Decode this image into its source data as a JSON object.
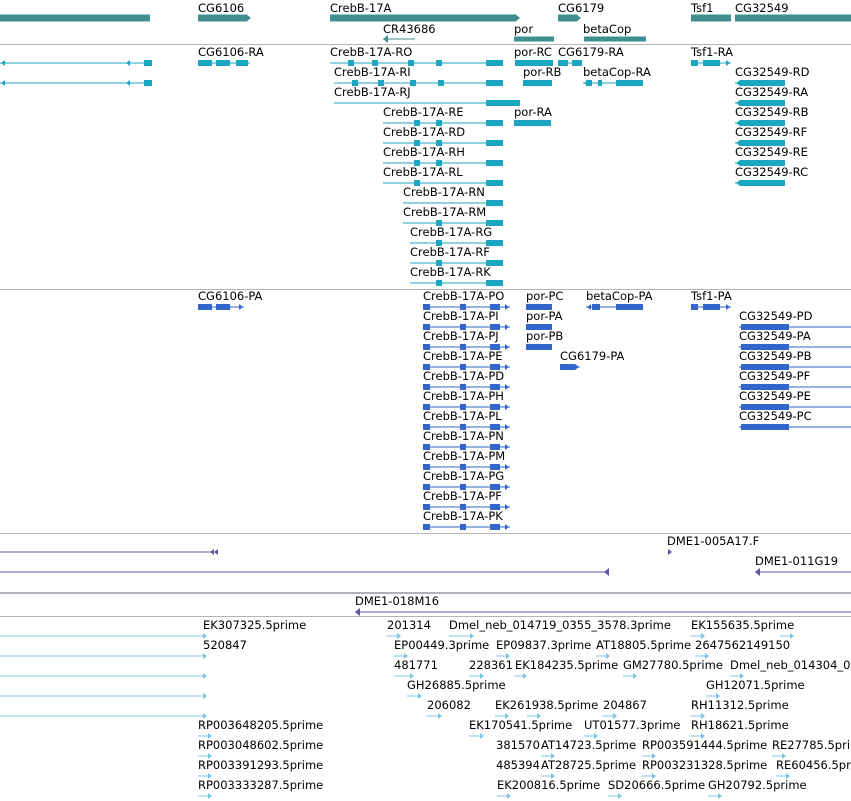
{
  "colors": {
    "gene": "#3f8f8f",
    "transcript": "#1ba6c2",
    "protein": "#3366cc",
    "bac": "#6650a8",
    "est": "#7fc3e0",
    "separator": "#b4b4b4"
  },
  "tracks": {
    "genes": [
      {
        "label": "CG6106"
      },
      {
        "label": "CrebB-17A"
      },
      {
        "label": "CG6179"
      },
      {
        "label": "Tsf1"
      },
      {
        "label": "CG32549"
      },
      {
        "label": "CR43686"
      },
      {
        "label": "por"
      },
      {
        "label": "betaCop"
      }
    ],
    "transcripts": [
      {
        "label": "CG6106-RA"
      },
      {
        "label": "CrebB-17A-RO"
      },
      {
        "label": "por-RC"
      },
      {
        "label": "CG6179-RA"
      },
      {
        "label": "Tsf1-RA"
      },
      {
        "label": "CrebB-17A-RI"
      },
      {
        "label": "por-RB"
      },
      {
        "label": "betaCop-RA"
      },
      {
        "label": "CG32549-RD"
      },
      {
        "label": "CrebB-17A-RJ"
      },
      {
        "label": "CG32549-RA"
      },
      {
        "label": "CrebB-17A-RE"
      },
      {
        "label": "por-RA"
      },
      {
        "label": "CG32549-RB"
      },
      {
        "label": "CrebB-17A-RD"
      },
      {
        "label": "CG32549-RF"
      },
      {
        "label": "CrebB-17A-RH"
      },
      {
        "label": "CG32549-RE"
      },
      {
        "label": "CrebB-17A-RL"
      },
      {
        "label": "CG32549-RC"
      },
      {
        "label": "CrebB-17A-RN"
      },
      {
        "label": "CrebB-17A-RM"
      },
      {
        "label": "CrebB-17A-RG"
      },
      {
        "label": "CrebB-17A-RF"
      },
      {
        "label": "CrebB-17A-RK"
      }
    ],
    "proteins": [
      {
        "label": "CG6106-PA"
      },
      {
        "label": "CrebB-17A-PO"
      },
      {
        "label": "por-PC"
      },
      {
        "label": "betaCop-PA"
      },
      {
        "label": "Tsf1-PA"
      },
      {
        "label": "CrebB-17A-PI"
      },
      {
        "label": "por-PA"
      },
      {
        "label": "CG32549-PD"
      },
      {
        "label": "CrebB-17A-PJ"
      },
      {
        "label": "por-PB"
      },
      {
        "label": "CG32549-PA"
      },
      {
        "label": "CrebB-17A-PE"
      },
      {
        "label": "CG6179-PA"
      },
      {
        "label": "CG32549-PB"
      },
      {
        "label": "CrebB-17A-PD"
      },
      {
        "label": "CG32549-PF"
      },
      {
        "label": "CrebB-17A-PH"
      },
      {
        "label": "CG32549-PE"
      },
      {
        "label": "CrebB-17A-PL"
      },
      {
        "label": "CG32549-PC"
      },
      {
        "label": "CrebB-17A-PN"
      },
      {
        "label": "CrebB-17A-PM"
      },
      {
        "label": "CrebB-17A-PG"
      },
      {
        "label": "CrebB-17A-PF"
      },
      {
        "label": "CrebB-17A-PK"
      }
    ],
    "bacs": [
      {
        "label": "DME1-005A17.F"
      },
      {
        "label": "DME1-011G19"
      },
      {
        "label": "DME1-018M16"
      }
    ],
    "ests": [
      {
        "label": "EK307325.5prime"
      },
      {
        "label": "201314"
      },
      {
        "label": "Dmel_neb_014719_0355_3578.3prime"
      },
      {
        "label": "EK155635.5prime"
      },
      {
        "label": "520847"
      },
      {
        "label": "EP00449.3prime"
      },
      {
        "label": "EP09837.3prime"
      },
      {
        "label": "AT18805.5prime"
      },
      {
        "label": "2647562149150"
      },
      {
        "label": "481771"
      },
      {
        "label": "228361"
      },
      {
        "label": "EK184235.5prime"
      },
      {
        "label": "GM27780.5prime"
      },
      {
        "label": "Dmel_neb_014304_0"
      },
      {
        "label": "GH26885.5prime"
      },
      {
        "label": "GH12071.5prime"
      },
      {
        "label": "206082"
      },
      {
        "label": "EK261938.5prime"
      },
      {
        "label": "204867"
      },
      {
        "label": "RH11312.5prime"
      },
      {
        "label": "RP003648205.5prime"
      },
      {
        "label": "EK170541.5prime"
      },
      {
        "label": "UT01577.3prime"
      },
      {
        "label": "RH18621.5prime"
      },
      {
        "label": "RP003048602.5prime"
      },
      {
        "label": "381570"
      },
      {
        "label": "AT14723.5prime"
      },
      {
        "label": "RP003591444.5prime"
      },
      {
        "label": "RE27785.5prime"
      },
      {
        "label": "RP003391293.5prime"
      },
      {
        "label": "485394"
      },
      {
        "label": "AT28725.5prime"
      },
      {
        "label": "RP003231328.5prime"
      },
      {
        "label": "RE60456.5prime"
      },
      {
        "label": "RP003333287.5prime"
      },
      {
        "label": "EK200816.5prime"
      },
      {
        "label": "SD20666.5prime"
      },
      {
        "label": "GH20792.5prime"
      }
    ]
  }
}
